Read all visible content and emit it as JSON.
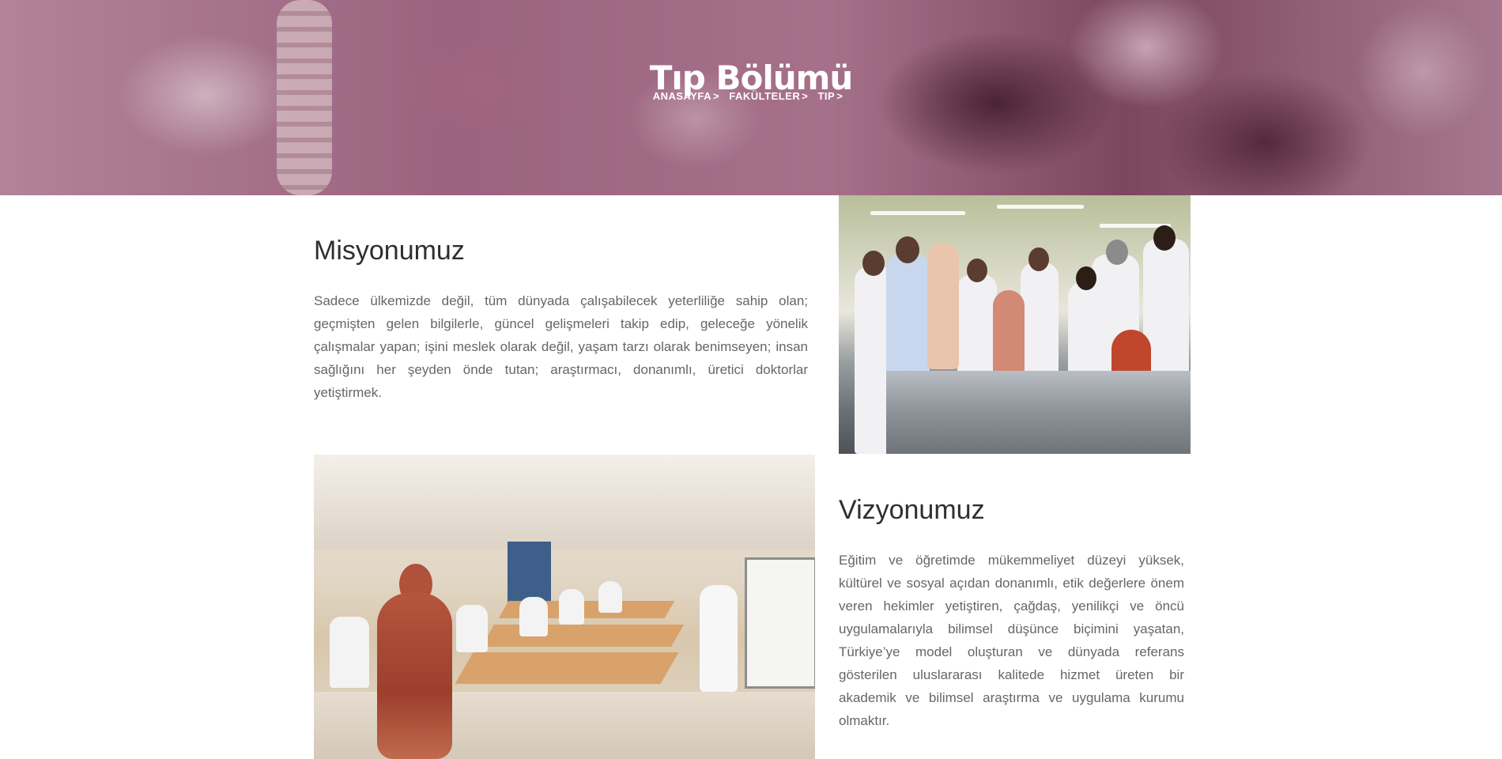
{
  "hero": {
    "title": "Tıp Bölümü",
    "breadcrumb": [
      "ANASAYFA",
      "FAKÜLTELER",
      "TIP"
    ],
    "separator": ">"
  },
  "mission": {
    "heading": "Misyonumuz",
    "text": "Sadece ülkemizde değil, tüm dünyada çalışabilecek yeterliliğe sahip olan; geçmişten gelen bilgilerle, güncel gelişmeleri takip edip, geleceğe yönelik çalışmalar yapan; işini meslek olarak değil, yaşam tarzı olarak benimseyen; insan sağlığını her şeyden önde tutan; araştırmacı, donanımlı, üretici doktorlar yetiştirmek."
  },
  "vision": {
    "heading": "Vizyonumuz",
    "text": "Eğitim ve öğretimde mükemmeliyet düzeyi yüksek, kültürel ve sosyal açıdan donanımlı, etik değerlere önem veren hekimler yetiştiren, çağdaş, yenilikçi ve öncü uygulamalarıyla bilimsel düşünce biçimini yaşatan, Türkiye’ye model oluşturan ve dünyada referans gösterilen uluslararası kalitede hizmet üreten bir akademik ve bilimsel araştırma ve uygulama kurumu olmaktır."
  },
  "colors": {
    "hero_overlay": "#7a2850",
    "heading": "#2f2f2f",
    "body_text": "#666666"
  }
}
